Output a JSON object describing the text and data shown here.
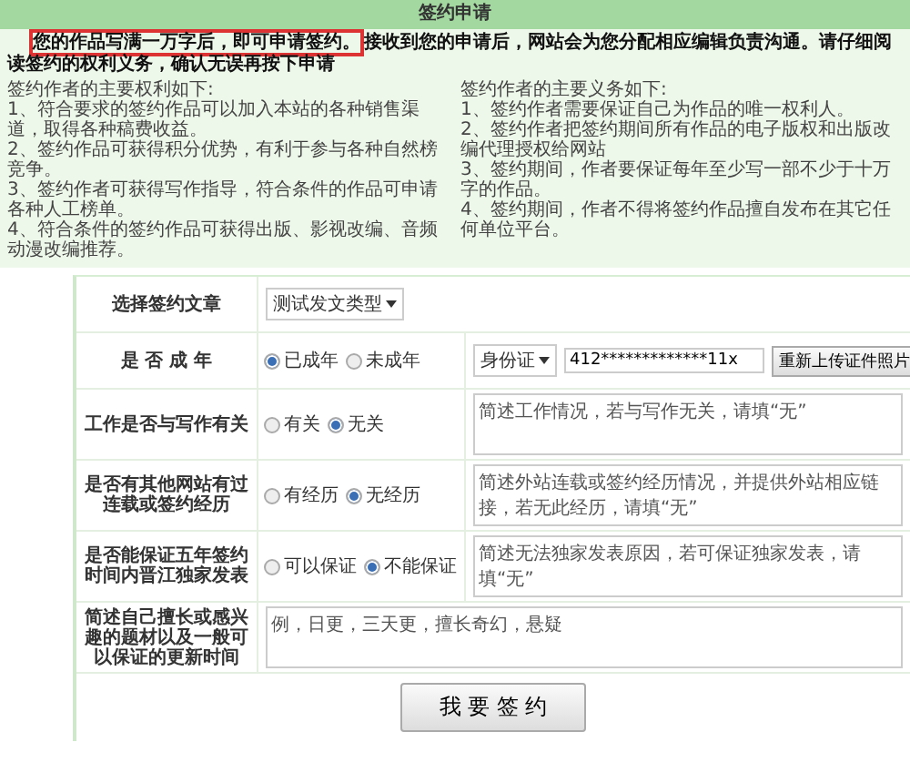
{
  "title": "签约申请",
  "notice": {
    "highlight": "您的作品写满一万字后，即可申请签约。",
    "rest": "接收到您的申请后，网站会为您分配相应编辑负责沟通。请仔细阅读签约的权利义务，确认无误再按下申请"
  },
  "rights": {
    "heading": "签约作者的主要权利如下:",
    "items": [
      "1、符合要求的签约作品可以加入本站的各种销售渠道，取得各种稿费收益。",
      "2、签约作品可获得积分优势，有利于参与各种自然榜竞争。",
      "3、签约作者可获得写作指导，符合条件的作品可申请各种人工榜单。",
      "4、符合条件的签约作品可获得出版、影视改编、音频动漫改编推荐。"
    ]
  },
  "duties": {
    "heading": "签约作者的主要义务如下:",
    "items": [
      "1、签约作者需要保证自己为作品的唯一权利人。",
      "2、签约作者把签约期间所有作品的电子版权和出版改编代理授权给网站",
      "3、签约期间，作者要保证每年至少写一部不少于十万字的作品。",
      "4、签约期间，作者不得将签约作品擅自发布在其它任何单位平台。"
    ]
  },
  "form": [
    {
      "kind": "select",
      "label": "选择签约文章",
      "value": "测试发文类型"
    },
    {
      "kind": "identity",
      "label": "是 否 成 年",
      "options": [
        {
          "label": "已成年",
          "selected": true
        },
        {
          "label": "未成年",
          "selected": false
        }
      ],
      "id_type": "身份证",
      "id_number": "412*************11x",
      "upload_button": "重新上传证件照片"
    },
    {
      "kind": "choice",
      "label": "工作是否与写作有关",
      "options": [
        {
          "label": "有关",
          "selected": false
        },
        {
          "label": "无关",
          "selected": true
        }
      ],
      "placeholder": "简述工作情况，若与写作无关，请填“无”"
    },
    {
      "kind": "choice",
      "label": "是否有其他网站有过连载或签约经历",
      "options": [
        {
          "label": "有经历",
          "selected": false
        },
        {
          "label": "无经历",
          "selected": true
        }
      ],
      "placeholder": "简述外站连载或签约经历情况，并提供外站相应链接，若无此经历，请填“无”"
    },
    {
      "kind": "choice",
      "label": "是否能保证五年签约时间内晋江独家发表",
      "options": [
        {
          "label": "可以保证",
          "selected": false
        },
        {
          "label": "不能保证",
          "selected": true
        }
      ],
      "placeholder": "简述无法独家发表原因，若可保证独家发表，请填“无”"
    },
    {
      "kind": "text",
      "label": "简述自己擅长或感兴趣的题材以及一般可以保证的更新时间",
      "placeholder": "例，日更，三天更，擅长奇幻，悬疑"
    }
  ],
  "submit": "我 要 签 约"
}
